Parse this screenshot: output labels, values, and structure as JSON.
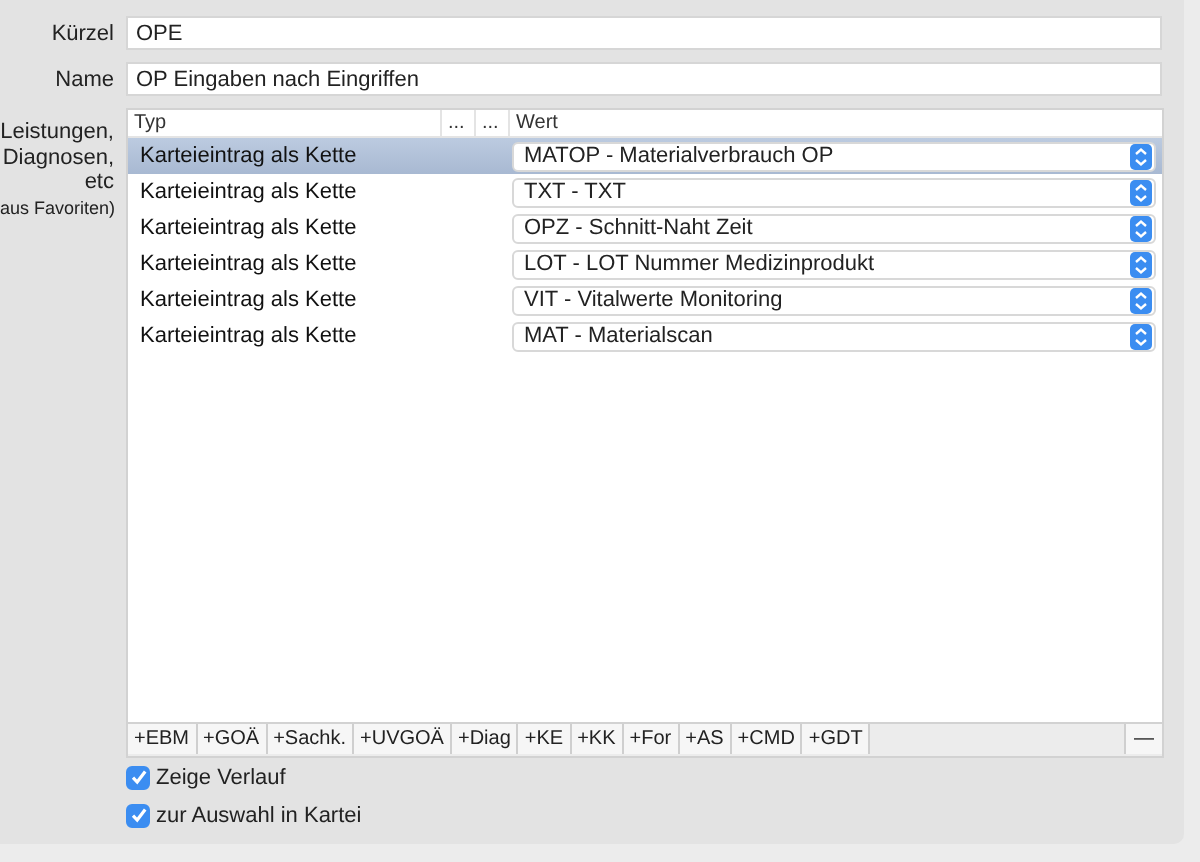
{
  "fields": [
    {
      "label": "Kürzel",
      "value": "OPE"
    },
    {
      "label": "Name",
      "value": "OP Eingaben nach Eingriffen"
    }
  ],
  "table": {
    "label_lines": [
      "Leistungen,",
      "Diagnosen,",
      "etc",
      "aus Favoriten)"
    ],
    "columns": [
      "Typ",
      "...",
      "...",
      "Wert"
    ],
    "rows": [
      {
        "typ": "Karteieintrag als Kette",
        "wert": "MATOP - Materialverbrauch OP",
        "selected": true
      },
      {
        "typ": "Karteieintrag als Kette",
        "wert": "TXT - TXT",
        "selected": false
      },
      {
        "typ": "Karteieintrag als Kette",
        "wert": "OPZ - Schnitt-Naht Zeit",
        "selected": false
      },
      {
        "typ": "Karteieintrag als Kette",
        "wert": "LOT - LOT Nummer Medizinprodukt",
        "selected": false
      },
      {
        "typ": "Karteieintrag als Kette",
        "wert": "VIT - Vitalwerte Monitoring",
        "selected": false
      },
      {
        "typ": "Karteieintrag als Kette",
        "wert": "MAT - Materialscan",
        "selected": false
      }
    ]
  },
  "add_buttons": [
    "+EBM",
    "+GOÄ",
    "+Sachk.",
    "+UVGOÄ",
    "+Diag",
    "+KE",
    "+KK",
    "+For",
    "+AS",
    "+CMD",
    "+GDT"
  ],
  "remove_button": "—",
  "checkboxes": [
    {
      "label": "Zeige Verlauf",
      "checked": true
    },
    {
      "label": "zur Auswahl in Kartei",
      "checked": true
    }
  ]
}
